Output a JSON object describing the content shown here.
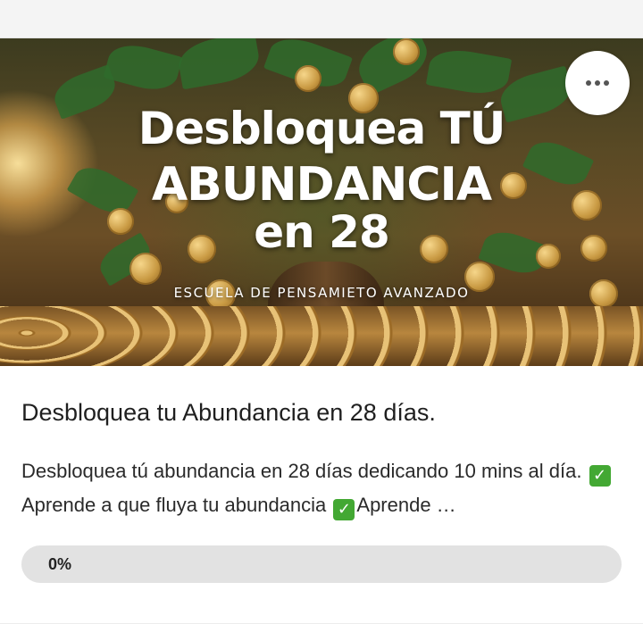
{
  "hero": {
    "title_line1": "Desbloquea TÚ",
    "title_line2": "ABUNDANCIA",
    "title_line3": "en 28",
    "subtitle": "ESCUELA DE PENSAMIETO AVANZADO",
    "more_icon": "more-horizontal-icon"
  },
  "course": {
    "title": "Desbloquea tu Abundancia en 28 días.",
    "desc_part1": "Desbloquea tú abundancia en 28 días dedicando 10 mins al día. ",
    "check_glyph": "✓",
    "desc_part2": "Aprende a que fluya tu abundancia ",
    "desc_part3": "Aprende …"
  },
  "progress": {
    "value": 0,
    "label": "0%"
  },
  "colors": {
    "check_green": "#43a833",
    "progress_track": "#e2e2e2"
  }
}
